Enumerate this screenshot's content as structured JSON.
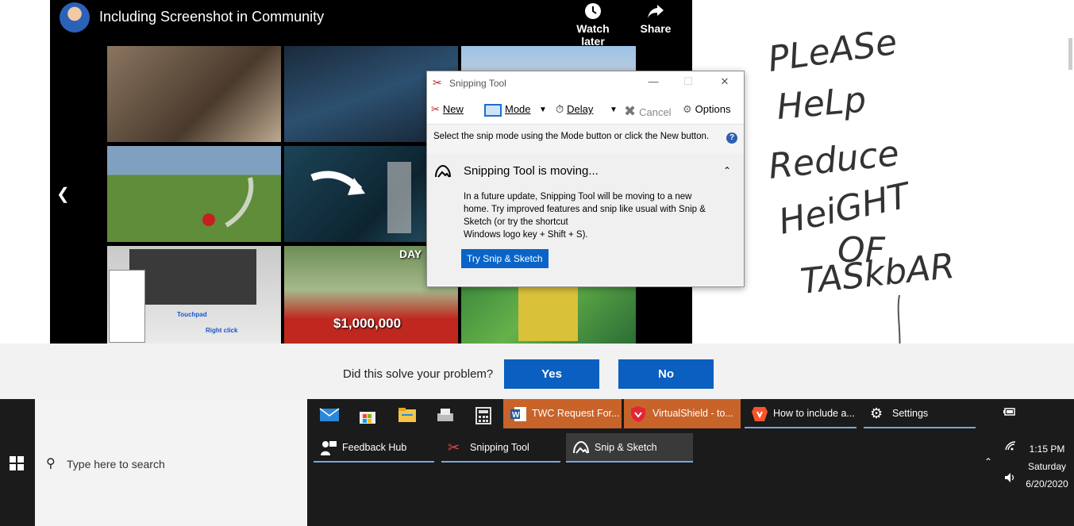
{
  "video": {
    "title": "Including Screenshot in Community",
    "watch_later": "Watch later",
    "share": "Share",
    "thumb_money": "$1,000,000",
    "thumb_day": "DAY",
    "thumb_touchpad": "Touchpad",
    "thumb_right_click": "Right click"
  },
  "snipping_tool": {
    "title": "Snipping Tool",
    "toolbar": {
      "new": "New",
      "mode": "Mode",
      "delay": "Delay",
      "cancel": "Cancel",
      "options": "Options"
    },
    "info": "Select the snip mode using the Mode button or click the New button.",
    "notice_title": "Snipping Tool is moving...",
    "notice_body": "In a future update, Snipping Tool will be moving to a new home. Try improved features and snip like usual with Snip & Sketch (or try the shortcut",
    "notice_shortcut": "Windows logo key + Shift + S).",
    "try_button": "Try Snip & Sketch"
  },
  "note": {
    "lines": [
      "PLeASe",
      "HeLp",
      "Reduce",
      "HeiGHT",
      "OF",
      "TASkbAR"
    ]
  },
  "feedback": {
    "question": "Did this solve your problem?",
    "yes": "Yes",
    "no": "No"
  },
  "taskbar": {
    "search_placeholder": "Type here to search",
    "tasks_row1": [
      {
        "label": "TWC Request For...",
        "icon": "word-icon"
      },
      {
        "label": "VirtualShield - to...",
        "icon": "shield-icon"
      },
      {
        "label": "How to include a...",
        "icon": "brave-icon"
      },
      {
        "label": "Settings",
        "icon": "gear-icon"
      }
    ],
    "tasks_row2": [
      {
        "label": "Feedback Hub",
        "icon": "feedback-icon"
      },
      {
        "label": "Snipping Tool",
        "icon": "scissors-icon"
      },
      {
        "label": "Snip & Sketch",
        "icon": "snip-sketch-icon"
      }
    ],
    "clock": {
      "time": "1:15 PM",
      "day": "Saturday",
      "date": "6/20/2020"
    }
  },
  "colors": {
    "accent_blue": "#0a5fc0",
    "taskbar_bg": "#1b1b1b",
    "task_orange": "#c8632a"
  }
}
